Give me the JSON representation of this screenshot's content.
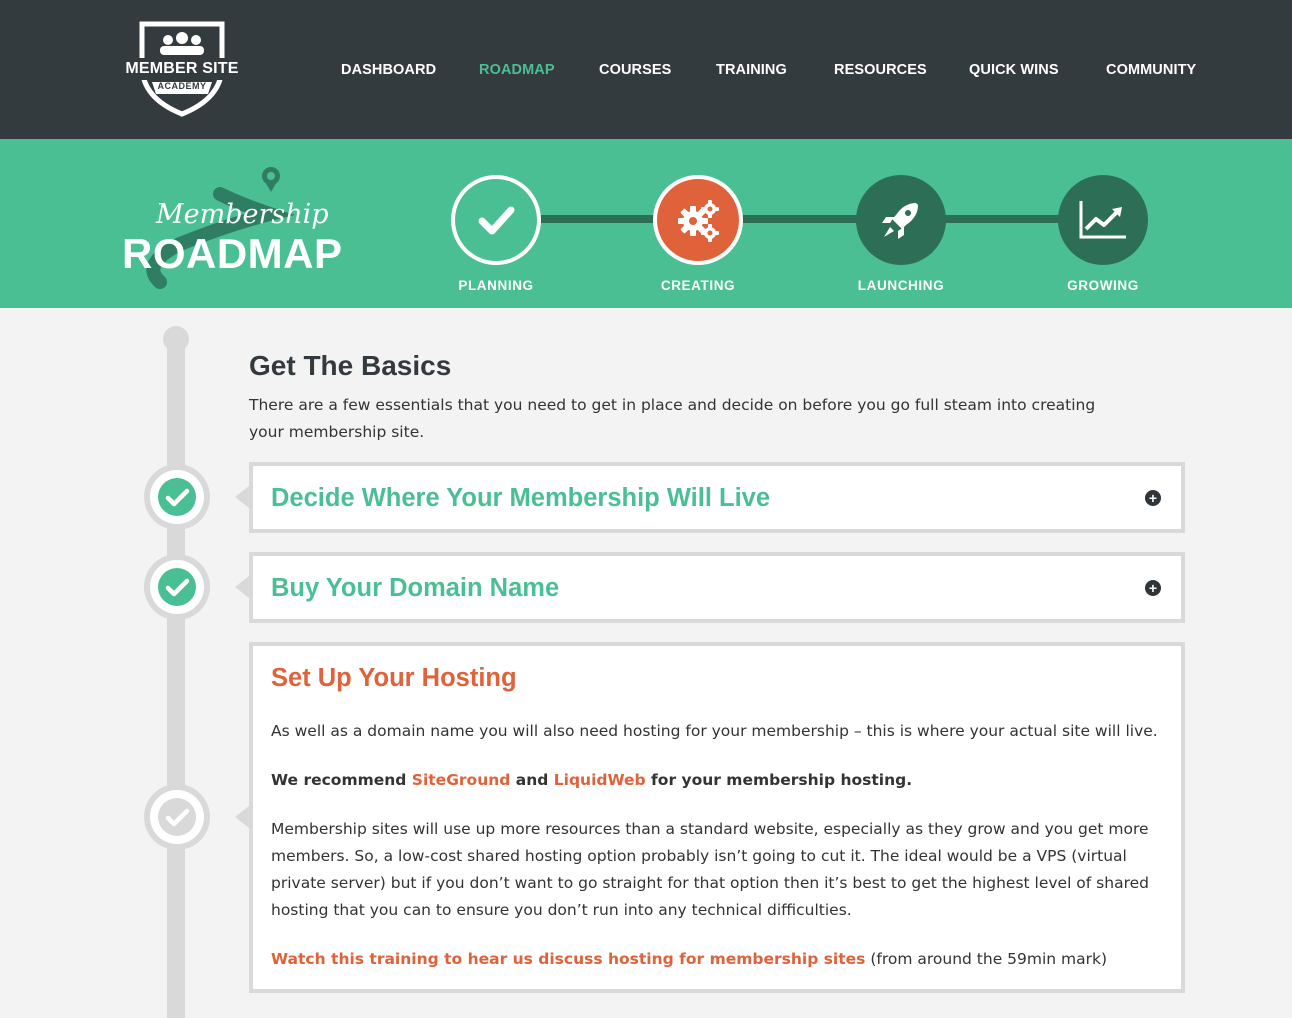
{
  "logo": {
    "line1": "MEMBER SITE",
    "line2": "ACADEMY"
  },
  "nav": {
    "items": [
      {
        "label": "DASHBOARD",
        "active": false
      },
      {
        "label": "ROADMAP",
        "active": true
      },
      {
        "label": "COURSES",
        "active": false
      },
      {
        "label": "TRAINING",
        "active": false
      },
      {
        "label": "RESOURCES",
        "active": false
      },
      {
        "label": "QUICK WINS",
        "active": false
      },
      {
        "label": "COMMUNITY",
        "active": false
      }
    ]
  },
  "roadmap": {
    "script": "Membership",
    "big": "ROADMAP",
    "steps": [
      {
        "label": "PLANNING",
        "icon": "checkmark-icon",
        "state": "complete"
      },
      {
        "label": "CREATING",
        "icon": "gears-icon",
        "state": "current"
      },
      {
        "label": "LAUNCHING",
        "icon": "rocket-icon",
        "state": "upcoming"
      },
      {
        "label": "GROWING",
        "icon": "chart-icon",
        "state": "upcoming"
      }
    ]
  },
  "colors": {
    "dark": "#343b3f",
    "green": "#4bbf94",
    "dark_green": "#2d6e57",
    "orange": "#e0623a",
    "gray": "#d9d9d9"
  },
  "section": {
    "title": "Get The Basics",
    "description": "There are a few essentials that you need to get in place and decide on before you go full steam into creating your membership site."
  },
  "cards": [
    {
      "title": "Decide Where Your Membership Will Live",
      "state": "complete",
      "expanded": false
    },
    {
      "title": "Buy Your Domain Name",
      "state": "complete",
      "expanded": false
    },
    {
      "title": "Set Up Your Hosting",
      "state": "current",
      "expanded": true,
      "p1": "As well as a domain name you will also need hosting for your membership – this is where your actual site will live.",
      "p2_pre": "We recommend ",
      "p2_link1": "SiteGround",
      "p2_mid": " and ",
      "p2_link2": "LiquidWeb",
      "p2_post": " for your membership hosting.",
      "p3": "Membership sites will use up more resources than a standard website, especially as they grow and you get more members. So, a low-cost shared hosting option probably isn’t going to cut it. The ideal would be a VPS (virtual private server) but if you don’t want to go straight for that option then it’s best to get the highest level of shared hosting that you can to ensure you don’t run into any technical difficulties.",
      "p4_link": "Watch this training to hear us discuss hosting for membership sites",
      "p4_post": " (from around the 59min mark)"
    }
  ]
}
